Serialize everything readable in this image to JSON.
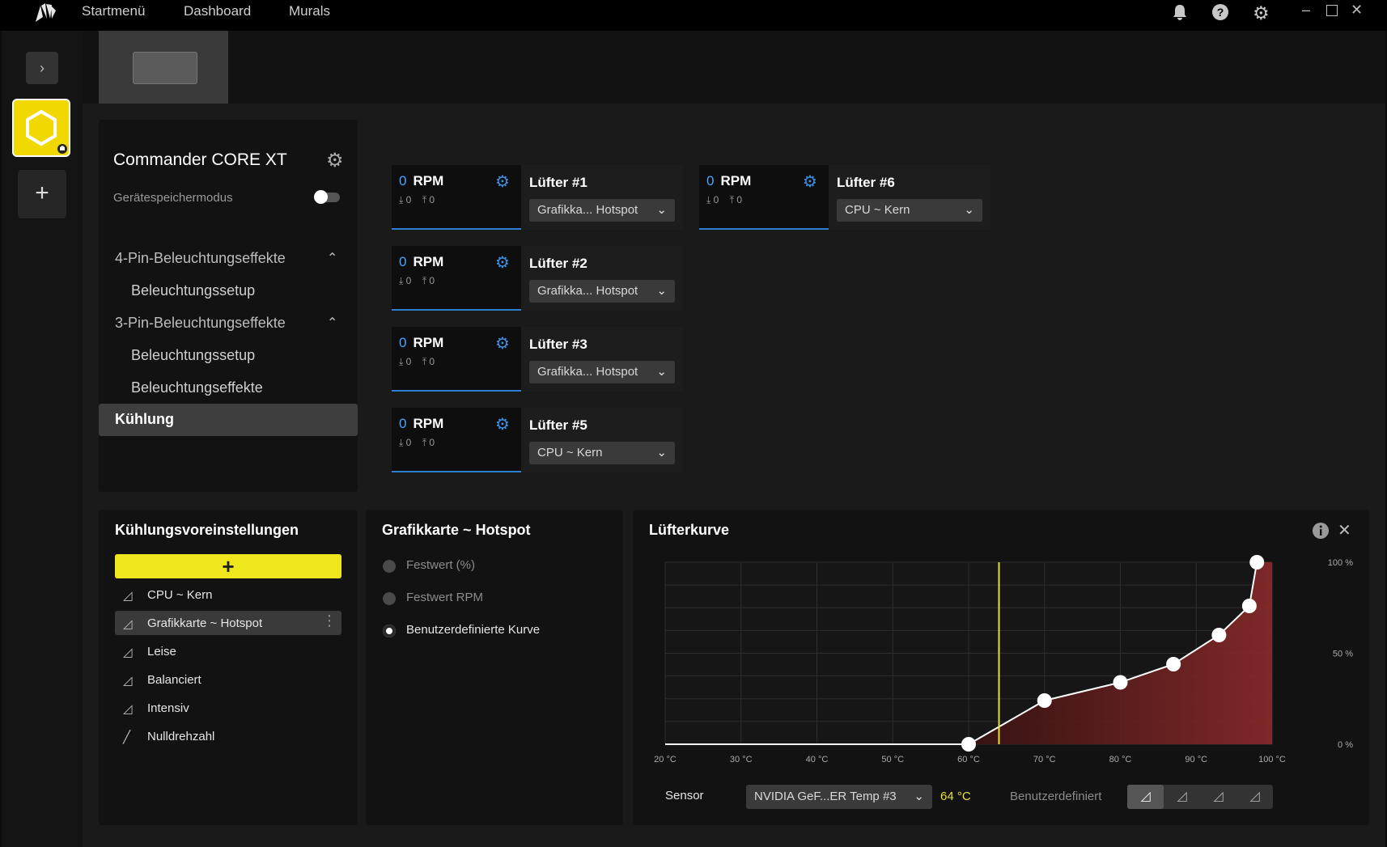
{
  "topbar": {
    "nav": [
      "Startmenü",
      "Dashboard",
      "Murals"
    ],
    "icons": [
      "corsair-logo-icon",
      "bell-icon",
      "help-icon",
      "settings-gear-icon",
      "minimize-icon",
      "maximize-icon",
      "close-icon"
    ]
  },
  "device": {
    "name": "Commander CORE XT",
    "memory_mode_label": "Gerätespeichermodus",
    "memory_mode_on": false
  },
  "menu": {
    "section1": "4-Pin-Beleuchtungseffekte",
    "section1_items": [
      "Beleuchtungssetup"
    ],
    "section2": "3-Pin-Beleuchtungseffekte",
    "section2_items": [
      "Beleuchtungssetup",
      "Beleuchtungseffekte"
    ],
    "active": "Kühlung"
  },
  "fans": [
    {
      "rpm": "0",
      "unit": "RPM",
      "min": "0",
      "max": "0",
      "name": "Lüfter #1",
      "source": "Grafikka... Hotspot"
    },
    {
      "rpm": "0",
      "unit": "RPM",
      "min": "0",
      "max": "0",
      "name": "Lüfter #2",
      "source": "Grafikka... Hotspot"
    },
    {
      "rpm": "0",
      "unit": "RPM",
      "min": "0",
      "max": "0",
      "name": "Lüfter #3",
      "source": "Grafikka... Hotspot"
    },
    {
      "rpm": "0",
      "unit": "RPM",
      "min": "0",
      "max": "0",
      "name": "Lüfter #5",
      "source": "CPU ~ Kern"
    },
    {
      "rpm": "0",
      "unit": "RPM",
      "min": "0",
      "max": "0",
      "name": "Lüfter #6",
      "source": "CPU ~ Kern"
    }
  ],
  "presets": {
    "title": "Kühlungsvoreinstellungen",
    "add_label": "+",
    "items": [
      "CPU ~ Kern",
      "Grafikkarte ~ Hotspot",
      "Leise",
      "Balanciert",
      "Intensiv",
      "Nulldrehzahl"
    ],
    "selected": "Grafikkarte ~ Hotspot"
  },
  "mode": {
    "title": "Grafikkarte ~ Hotspot",
    "options": [
      "Festwert (%)",
      "Festwert RPM",
      "Benutzerdefinierte Kurve"
    ],
    "selected": "Benutzerdefinierte Kurve"
  },
  "curve": {
    "title": "Lüfterkurve",
    "sensor_label": "Sensor",
    "sensor_value": "NVIDIA GeF...ER Temp #3",
    "current_temp": "64 °C",
    "profile_label": "Benutzerdefiniert",
    "accent": "#e8e03a"
  },
  "chart_data": {
    "type": "area",
    "xlim": [
      20,
      100
    ],
    "ylim": [
      0,
      100
    ],
    "x_ticks": [
      "20 °C",
      "30 °C",
      "40 °C",
      "50 °C",
      "60 °C",
      "70 °C",
      "80 °C",
      "90 °C",
      "100 °C"
    ],
    "y_ticks": [
      "100 %",
      "50 %",
      "0 %"
    ],
    "points": [
      [
        60,
        0
      ],
      [
        70,
        24
      ],
      [
        80,
        34
      ],
      [
        87,
        44
      ],
      [
        93,
        60
      ],
      [
        97,
        76
      ],
      [
        98,
        100
      ]
    ],
    "current_x": 64,
    "grid": true
  }
}
